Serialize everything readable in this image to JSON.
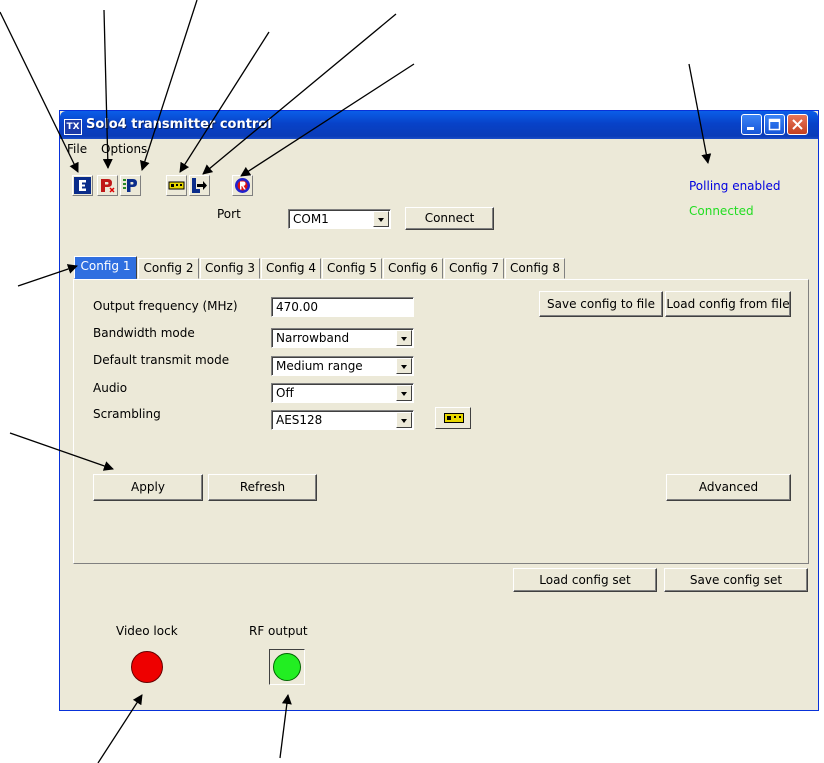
{
  "window": {
    "title": "Solo4 transmitter control",
    "app_icon_text": "TX"
  },
  "menu": {
    "file": "File",
    "options": "Options"
  },
  "toolbar": {
    "icons": [
      "e-icon",
      "p-cancel-icon",
      "p-icon",
      "key-icon",
      "exit-arrow-icon",
      "r-circle-icon"
    ]
  },
  "status": {
    "polling": "Polling enabled",
    "connected": "Connected",
    "polling_color": "#0000e0",
    "connected_color": "#22dd22"
  },
  "port": {
    "label": "Port",
    "value": "COM1",
    "connect_label": "Connect"
  },
  "tabs": [
    "Config 1",
    "Config 2",
    "Config 3",
    "Config 4",
    "Config 5",
    "Config 6",
    "Config 7",
    "Config 8"
  ],
  "config": {
    "fields": [
      {
        "label": "Output frequency (MHz)",
        "value": "470.00"
      },
      {
        "label": "Bandwidth mode",
        "value": "Narrowband"
      },
      {
        "label": "Default transmit mode",
        "value": "Medium range"
      },
      {
        "label": "Audio",
        "value": "Off"
      },
      {
        "label": "Scrambling",
        "value": "AES128"
      }
    ],
    "save_to_file": "Save config to file",
    "load_from_file": "Load config from file",
    "apply": "Apply",
    "refresh": "Refresh",
    "advanced": "Advanced"
  },
  "config_set": {
    "load": "Load config set",
    "save": "Save config set"
  },
  "indicators": {
    "video_lock": {
      "label": "Video lock",
      "color": "#ee0000"
    },
    "rf_output": {
      "label": "RF output",
      "color": "#22ee22"
    }
  },
  "accent": "#0a5ee8"
}
